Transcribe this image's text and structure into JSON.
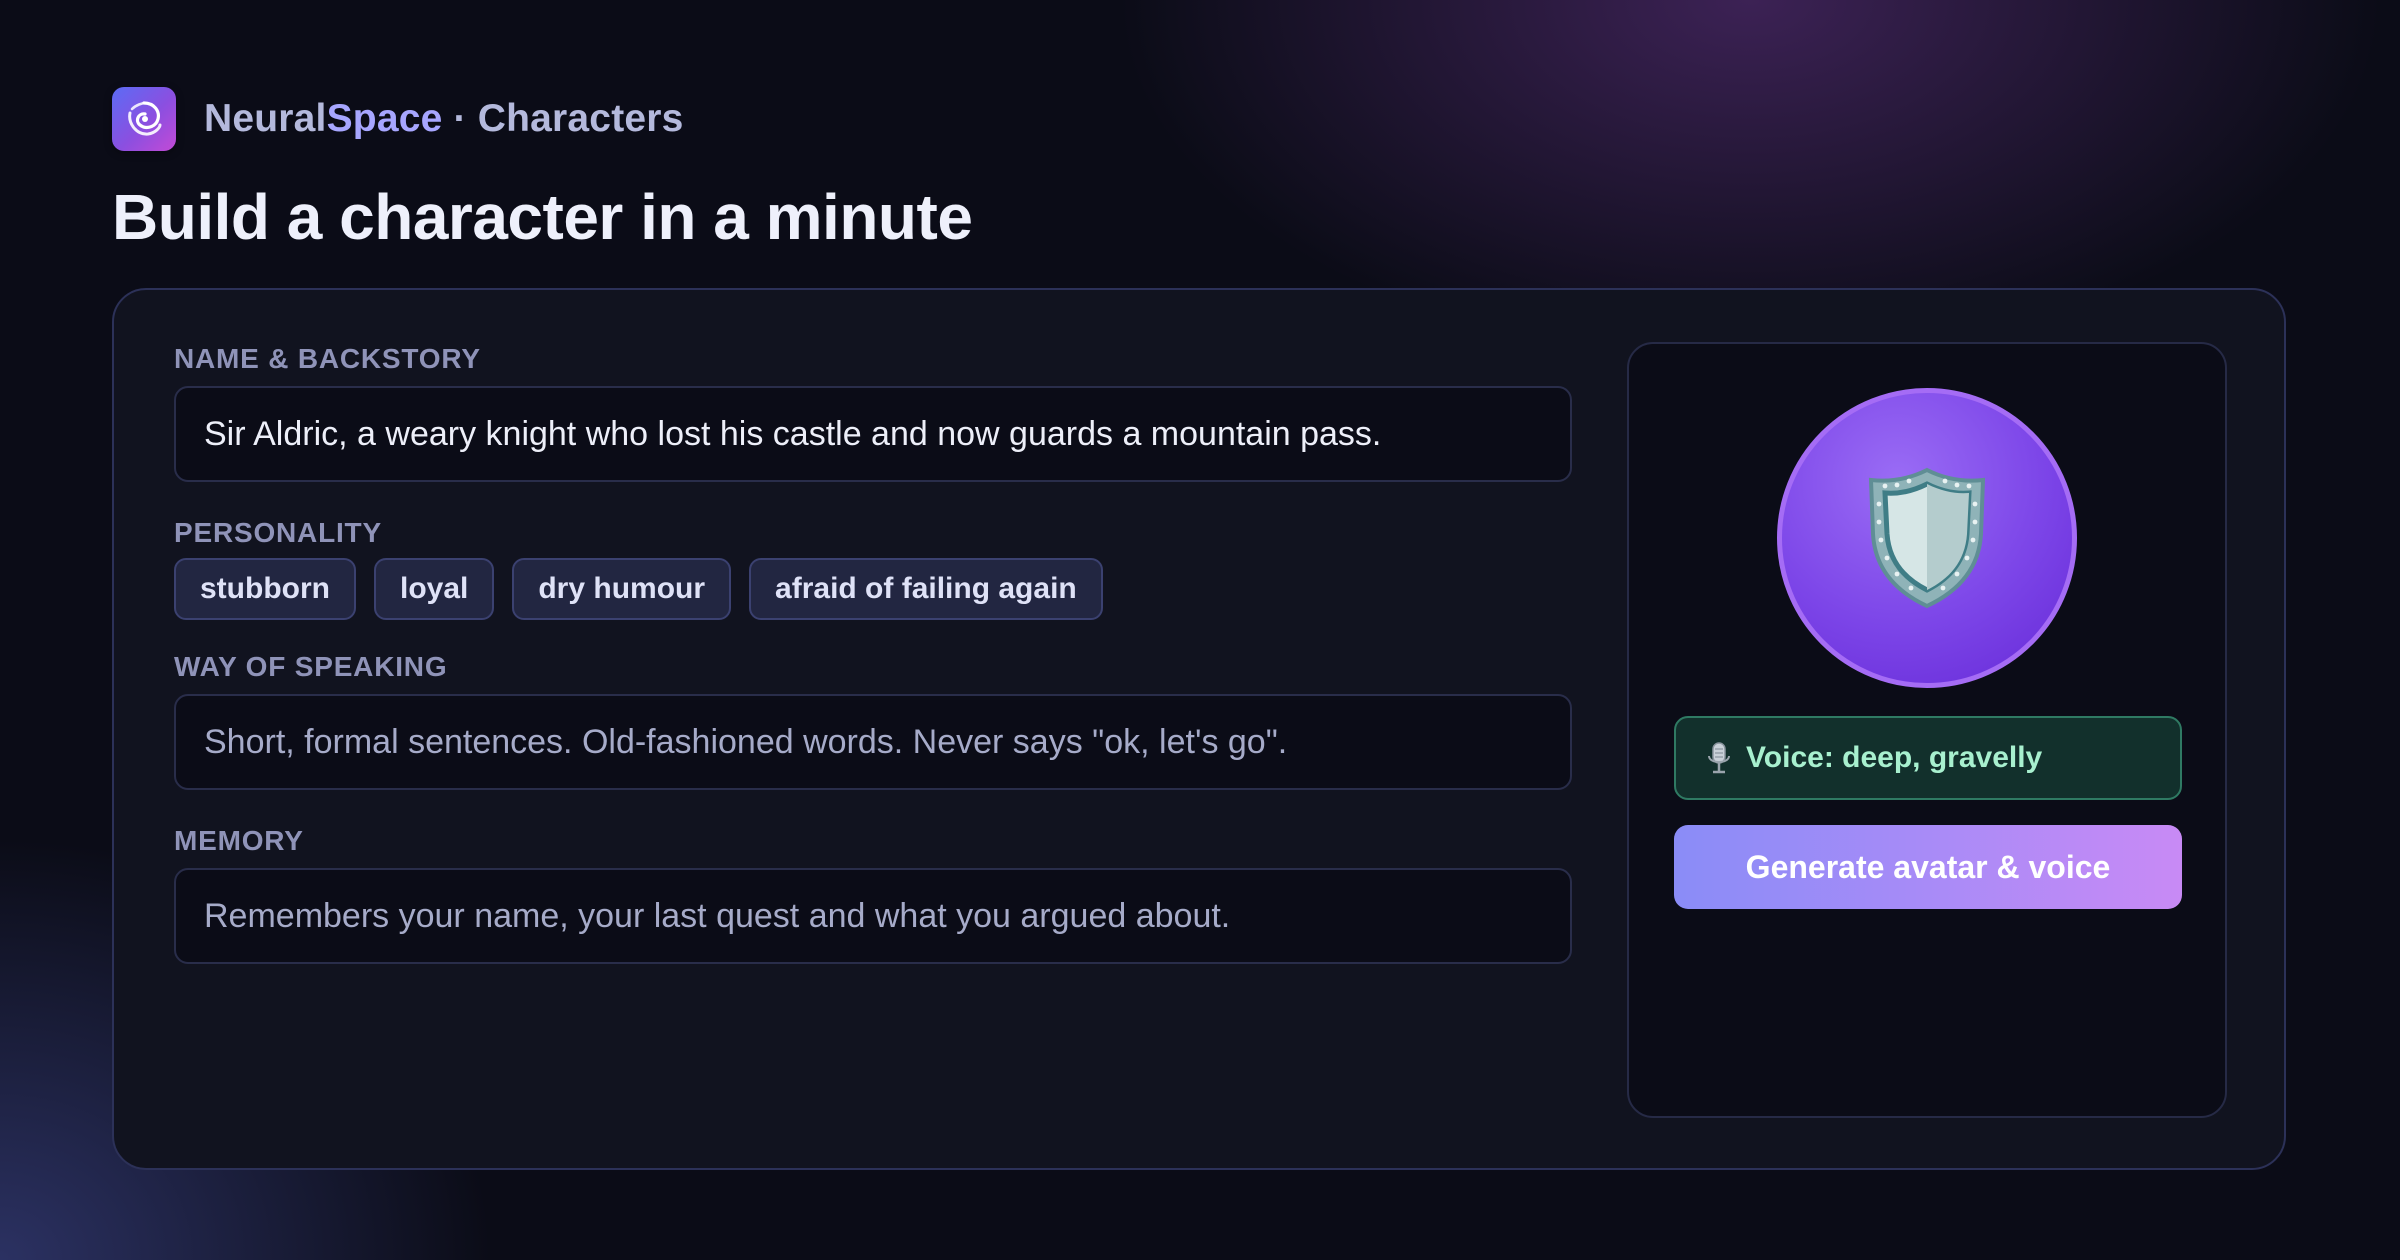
{
  "brand": {
    "name_part1": "Neural",
    "name_part2": "Space",
    "separator": " · ",
    "section": "Characters",
    "logo_icon": "galaxy-swirl-icon"
  },
  "page": {
    "title": "Build a character in a minute"
  },
  "form": {
    "backstory": {
      "label": "NAME & BACKSTORY",
      "value": "Sir Aldric, a weary knight who lost his castle and now guards a mountain pass."
    },
    "personality": {
      "label": "PERSONALITY",
      "traits": [
        "stubborn",
        "loyal",
        "dry humour",
        "afraid of failing again"
      ]
    },
    "speaking": {
      "label": "WAY OF SPEAKING",
      "placeholder": "Short, formal sentences. Old-fashioned words. Never says \"ok, let's go\"."
    },
    "memory": {
      "label": "MEMORY",
      "placeholder": "Remembers your name, your last quest and what you argued about."
    }
  },
  "side_panel": {
    "avatar_icon": "shield-icon",
    "voice_icon": "microphone-icon",
    "voice_label": "Voice: deep, gravelly",
    "generate_label": "Generate avatar & voice"
  },
  "colors": {
    "background": "#0b0c17",
    "card": "#11131f",
    "accent_purple": "#7c45e8",
    "voice_green": "#a8f0cf",
    "button_gradient_start": "#8a8cf7",
    "button_gradient_end": "#c88af5"
  }
}
